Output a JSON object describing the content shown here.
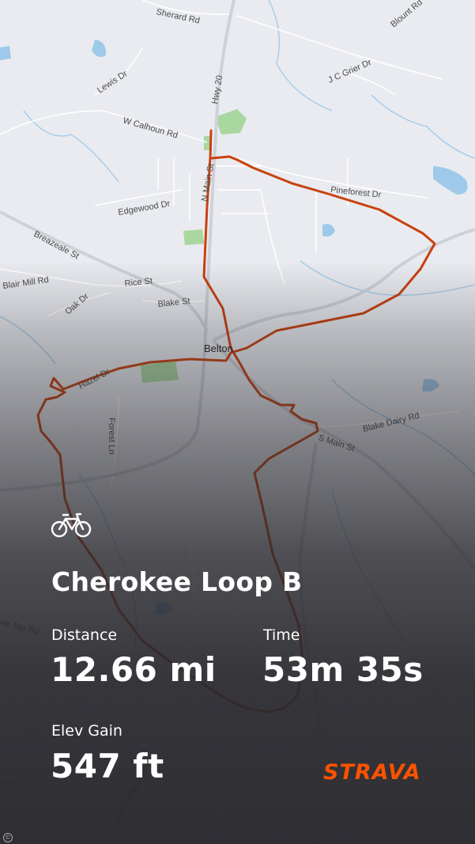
{
  "activity": {
    "type_icon": "bicycle-icon",
    "title": "Cherokee Loop B"
  },
  "stats": {
    "distance": {
      "label": "Distance",
      "value": "12.66 mi"
    },
    "time": {
      "label": "Time",
      "value": "53m 35s"
    },
    "elev_gain": {
      "label": "Elev Gain",
      "value": "547 ft"
    }
  },
  "brand": {
    "name": "STRAVA",
    "color": "#fc5200"
  },
  "map": {
    "route_color": "#c8410f",
    "labels": {
      "sherard": "Sherard Rd",
      "blount": "Blount Rd",
      "jcgrier": "J C Grier Dr",
      "lewis": "Lewis Dr",
      "hwy20": "Hwy 20",
      "wcalhoun": "W Calhoun Rd",
      "edgewood": "Edgewood Dr",
      "nmain": "N Main St",
      "pineforest": "Pineforest Dr",
      "breazeale": "Breazeale St",
      "blairmill": "Blair Mill Rd",
      "rice": "Rice St",
      "oak": "Oak Dr",
      "blake": "Blake St",
      "belton": "Belton",
      "hazel": "Hazel Dr",
      "forest": "Forest Ln",
      "blakedairy": "Blake Dairy Rd",
      "smain": "S Main St",
      "toprd": "ne Top Rd",
      "henrythomas": "Henry Thomas Rd",
      "trd": "t Rd"
    }
  }
}
